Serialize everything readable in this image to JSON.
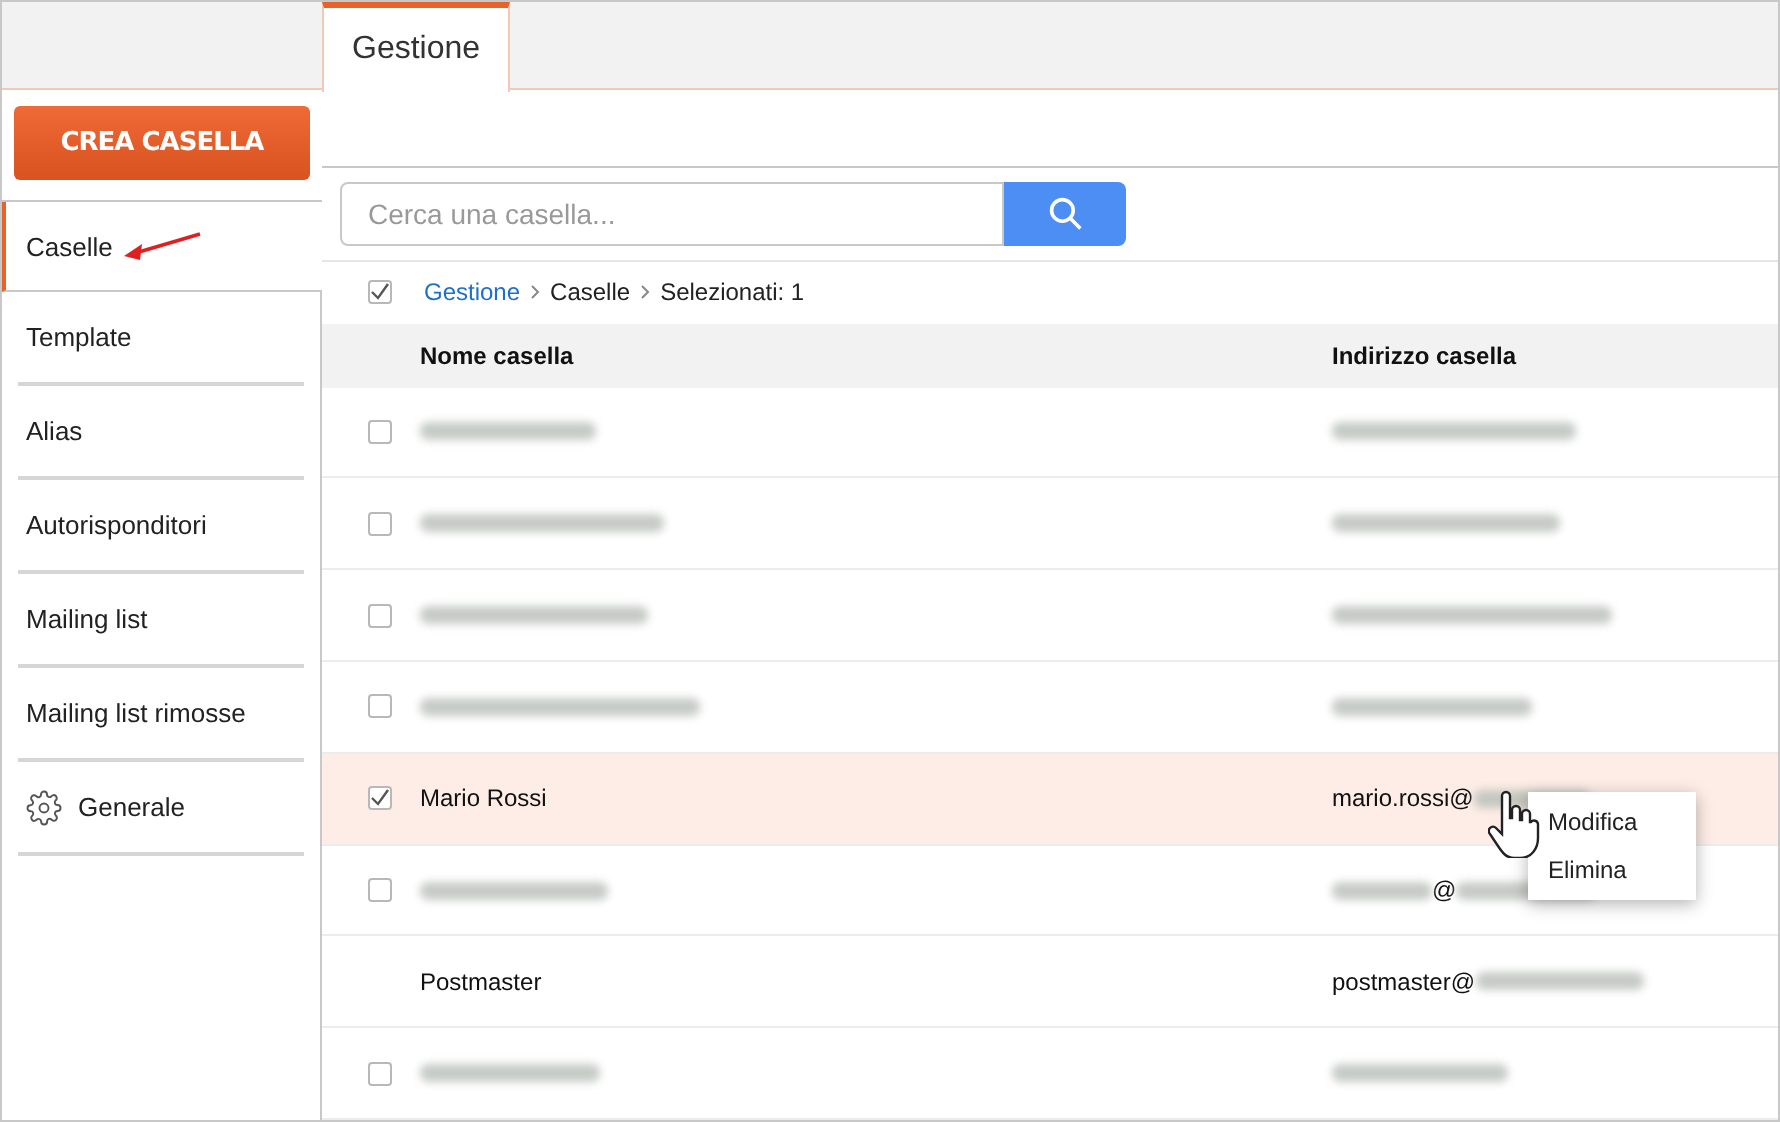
{
  "tabs": [
    {
      "label": "Gestione",
      "selected": true
    }
  ],
  "create_button": {
    "label": "CREA CASELLA"
  },
  "sidebar": {
    "items": [
      {
        "label": "Caselle",
        "selected": true,
        "pointer_arrow": true
      },
      {
        "label": "Template",
        "selected": false
      },
      {
        "label": "Alias",
        "selected": false
      },
      {
        "label": "Autorisponditori",
        "selected": false
      },
      {
        "label": "Mailing list",
        "selected": false
      },
      {
        "label": "Mailing list rimosse",
        "selected": false
      },
      {
        "label": "Generale",
        "selected": false,
        "kind": "settings"
      }
    ]
  },
  "search": {
    "placeholder": "Cerca una casella..."
  },
  "breadcrumb": {
    "select_all_checked": true,
    "items": [
      "Gestione",
      "Caselle",
      "Selezionati: 1"
    ]
  },
  "table": {
    "columns": [
      "Nome casella",
      "Indirizzo casella"
    ],
    "rows": [
      {
        "kind": "mailbox",
        "checked": false,
        "selected": false,
        "name": [
          {
            "kind": "blur"
          }
        ],
        "address": [
          {
            "kind": "blur"
          }
        ]
      },
      {
        "kind": "mailbox",
        "checked": false,
        "selected": false,
        "name": [
          {
            "kind": "blur"
          }
        ],
        "address": [
          {
            "kind": "blur"
          }
        ]
      },
      {
        "kind": "mailbox",
        "checked": false,
        "selected": false,
        "name": [
          {
            "kind": "blur"
          }
        ],
        "address": [
          {
            "kind": "blur"
          }
        ]
      },
      {
        "kind": "mailbox",
        "checked": false,
        "selected": false,
        "name": [
          {
            "kind": "blur"
          }
        ],
        "address": [
          {
            "kind": "blur"
          }
        ]
      },
      {
        "kind": "mailbox",
        "checked": true,
        "selected": true,
        "name": [
          {
            "kind": "text",
            "text": "Mario Rossi"
          }
        ],
        "address": [
          {
            "kind": "text",
            "text": "mario.rossi@"
          },
          {
            "kind": "blur"
          }
        ]
      },
      {
        "kind": "mailbox",
        "checked": false,
        "selected": false,
        "name": [
          {
            "kind": "blur"
          }
        ],
        "address": [
          {
            "kind": "blur"
          },
          {
            "kind": "text",
            "text": "@"
          },
          {
            "kind": "blur"
          }
        ]
      },
      {
        "kind": "system",
        "selected": false,
        "name": [
          {
            "kind": "text",
            "text": "Postmaster"
          }
        ],
        "address": [
          {
            "kind": "text",
            "text": "postmaster@"
          },
          {
            "kind": "blur"
          }
        ]
      },
      {
        "kind": "mailbox",
        "checked": false,
        "selected": false,
        "name": [
          {
            "kind": "blur"
          }
        ],
        "address": [
          {
            "kind": "blur"
          }
        ]
      }
    ]
  },
  "context_menu": {
    "items": [
      "Modifica",
      "Elimina"
    ]
  }
}
